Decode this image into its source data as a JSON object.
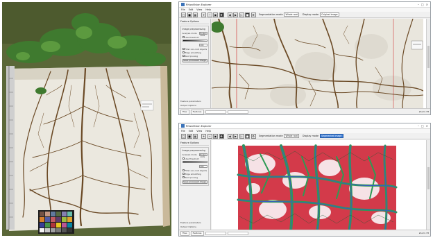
{
  "windows": [
    {
      "id": "top",
      "title": "RhizoVision Explorer",
      "menu": [
        "File",
        "Edit",
        "View",
        "Help"
      ],
      "toolbar": {
        "segmentation_label": "Segmentation mode",
        "segmentation_value": "Whole root",
        "display_label": "Display mode",
        "display_value": "Original image"
      },
      "panel": {
        "heading": "Feature Options",
        "image_options_title": "Image preprocessing",
        "analysis_mode_label": "Analysis mode",
        "analysis_mode_value": "Broken roots",
        "checkbox_1": "Use threshold",
        "threshold_value": "200",
        "checkbox_2": "Filter non-root objects",
        "checkbox_3": "Edge smoothing",
        "checkbox_4": "Root pruning",
        "button_label": "Save processed image",
        "collapsed_1": "Feature parameters",
        "collapsed_2": "Output Options"
      },
      "status": {
        "tab_1": "Files",
        "tab_2": "Features",
        "right_text": "Zoom: Fit"
      }
    },
    {
      "id": "bottom",
      "title": "RhizoVision Explorer",
      "menu": [
        "File",
        "Edit",
        "View",
        "Help"
      ],
      "toolbar": {
        "segmentation_label": "Segmentation mode",
        "segmentation_value": "Whole root",
        "display_label": "Display mode",
        "display_value": "Segmented image"
      },
      "panel": {
        "heading": "Feature Options",
        "image_options_title": "Image preprocessing",
        "analysis_mode_label": "Analysis mode",
        "analysis_mode_value": "Broken roots",
        "checkbox_1": "Use threshold",
        "threshold_value": "200",
        "checkbox_2": "Filter non-root objects",
        "checkbox_3": "Edge smoothing",
        "checkbox_4": "Root pruning",
        "button_label": "Save processed image",
        "collapsed_1": "Feature parameters",
        "collapsed_2": "Output Options"
      },
      "status": {
        "tab_1": "Files",
        "tab_2": "Features",
        "right_text": "Zoom: Fit"
      }
    }
  ],
  "icons": [
    "open-icon",
    "save-icon",
    "folder-icon",
    "zoom-in-icon",
    "zoom-out-icon",
    "fit-icon",
    "pan-icon",
    "previous-icon",
    "next-icon",
    "play-icon",
    "stop-icon",
    "settings-icon"
  ],
  "colors": {
    "background": "#ffffff",
    "window_chrome": "#f0f0f0",
    "root_brown": "#6b4a26",
    "board_white": "#ebe8df",
    "foliage_green": "#3f7a2f",
    "segment_green": "#2e9a54",
    "segment_red": "#d33a4a",
    "segment_blue": "#3a58c8",
    "highlight_blue": "#3a7bd5"
  }
}
